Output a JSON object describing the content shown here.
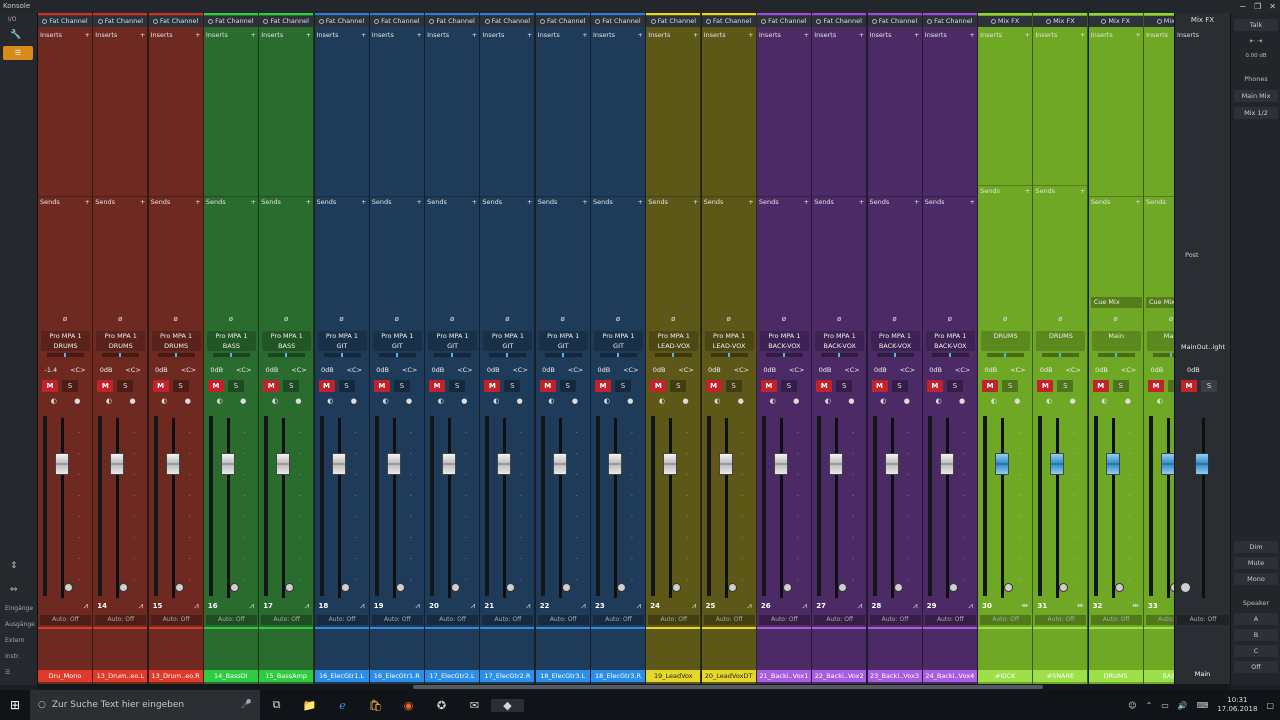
{
  "window": {
    "title": "Konsole",
    "controls": [
      "−",
      "❐",
      "✕"
    ]
  },
  "leftbar": {
    "io_label": "I/O",
    "orange_button": "☰",
    "bottom_buttons": [
      "Eingänge",
      "Ausgänge",
      "Extern",
      "Instr.",
      "☰"
    ]
  },
  "channels": [
    {
      "color": "#6e2a20",
      "top": "#c0392b",
      "header": "Fat Channel",
      "insert": "Inserts",
      "sends": "Sends",
      "plugin1": "Pro MPA 1",
      "plugin2": "DRUMS",
      "gain": "-1.4",
      "num": "",
      "name": "Dru_Mono",
      "band": "#e03a2a",
      "knob": "20"
    },
    {
      "color": "#6e2a20",
      "top": "#c0392b",
      "header": "Fat Channel",
      "insert": "Inserts",
      "sends": "Sends",
      "plugin1": "Pro MPA 1",
      "plugin2": "DRUMS",
      "gain": "0dB",
      "num": "14",
      "name": "13_Drum..eo.L",
      "band": "#e03a2a"
    },
    {
      "color": "#6e2a20",
      "top": "#c0392b",
      "header": "Fat Channel",
      "insert": "Inserts",
      "sends": "Sends",
      "plugin1": "Pro MPA 1",
      "plugin2": "DRUMS",
      "gain": "0dB",
      "num": "15",
      "name": "13_Drum..eo.R",
      "band": "#e03a2a"
    },
    {
      "color": "#2a6b2e",
      "top": "#2ecc40",
      "header": "Fat Channel",
      "insert": "Inserts",
      "sends": "Sends",
      "plugin1": "Pro MPA 1",
      "plugin2": "BASS",
      "gain": "0dB",
      "num": "16",
      "name": "14_BassDI",
      "band": "#2ecc40"
    },
    {
      "color": "#2a6b2e",
      "top": "#2ecc40",
      "header": "Fat Channel",
      "insert": "Inserts",
      "sends": "Sends",
      "plugin1": "Pro MPA 1",
      "plugin2": "BASS",
      "gain": "0dB",
      "num": "17",
      "name": "15_BassAmp",
      "band": "#2ecc40"
    },
    {
      "color": "#1f3b5a",
      "top": "#2d7dd2",
      "header": "Fat Channel",
      "insert": "Inserts",
      "sends": "Sends",
      "plugin1": "Pro MPA 1",
      "plugin2": "GIT",
      "gain": "0dB",
      "num": "18",
      "name": "16_ElecGtr1.L",
      "band": "#2d8ee8"
    },
    {
      "color": "#1f3b5a",
      "top": "#2d7dd2",
      "header": "Fat Channel",
      "insert": "Inserts",
      "sends": "Sends",
      "plugin1": "Pro MPA 1",
      "plugin2": "GIT",
      "gain": "0dB",
      "num": "19",
      "name": "16_ElecGtr1.R",
      "band": "#2d8ee8"
    },
    {
      "color": "#1f3b5a",
      "top": "#2d7dd2",
      "header": "Fat Channel",
      "insert": "Inserts",
      "sends": "Sends",
      "plugin1": "Pro MPA 1",
      "plugin2": "GIT",
      "gain": "0dB",
      "num": "20",
      "name": "17_ElecGtr2.L",
      "band": "#2d8ee8"
    },
    {
      "color": "#1f3b5a",
      "top": "#2d7dd2",
      "header": "Fat Channel",
      "insert": "Inserts",
      "sends": "Sends",
      "plugin1": "Pro MPA 1",
      "plugin2": "GIT",
      "gain": "0dB",
      "num": "21",
      "name": "17_ElecGtr2.R",
      "band": "#2d8ee8"
    },
    {
      "color": "#1f3b5a",
      "top": "#2d7dd2",
      "header": "Fat Channel",
      "insert": "Inserts",
      "sends": "Sends",
      "plugin1": "Pro MPA 1",
      "plugin2": "GIT",
      "gain": "0dB",
      "num": "22",
      "name": "18_ElecGtr3.L",
      "band": "#2d8ee8"
    },
    {
      "color": "#1f3b5a",
      "top": "#2d7dd2",
      "header": "Fat Channel",
      "insert": "Inserts",
      "sends": "Sends",
      "plugin1": "Pro MPA 1",
      "plugin2": "GIT",
      "gain": "0dB",
      "num": "23",
      "name": "18_ElecGtr3.R",
      "band": "#2d8ee8"
    },
    {
      "color": "#5e5818",
      "top": "#e5d82a",
      "header": "Fat Channel",
      "insert": "Inserts",
      "sends": "Sends",
      "plugin1": "Pro MPA 1",
      "plugin2": "LEAD-VOX",
      "gain": "0dB",
      "num": "24",
      "name": "19_LeadVox",
      "band": "#e5d82a"
    },
    {
      "color": "#5e5818",
      "top": "#e5d82a",
      "header": "Fat Channel",
      "insert": "Inserts",
      "sends": "Sends",
      "plugin1": "Pro MPA 1",
      "plugin2": "LEAD-VOX",
      "gain": "0dB",
      "num": "25",
      "name": "20_LeadVoxDT",
      "band": "#e5d82a"
    },
    {
      "color": "#4b2a66",
      "top": "#9b4fd4",
      "header": "Fat Channel",
      "insert": "Inserts",
      "sends": "Sends",
      "plugin1": "Pro MPA 1",
      "plugin2": "BACK-VOX",
      "gain": "0dB",
      "num": "26",
      "name": "21_Backi..Vox1",
      "band": "#a85ee0"
    },
    {
      "color": "#4b2a66",
      "top": "#9b4fd4",
      "header": "Fat Channel",
      "insert": "Inserts",
      "sends": "Sends",
      "plugin1": "Pro MPA 1",
      "plugin2": "BACK-VOX",
      "gain": "0dB",
      "num": "27",
      "name": "22_Backi..Vox2",
      "band": "#a85ee0"
    },
    {
      "color": "#4b2a66",
      "top": "#9b4fd4",
      "header": "Fat Channel",
      "insert": "Inserts",
      "sends": "Sends",
      "plugin1": "Pro MPA 1",
      "plugin2": "BACK-VOX",
      "gain": "0dB",
      "num": "28",
      "name": "23_Backi..Vox3",
      "band": "#a85ee0"
    },
    {
      "color": "#4b2a66",
      "top": "#9b4fd4",
      "header": "Fat Channel",
      "insert": "Inserts",
      "sends": "Sends",
      "plugin1": "Pro MPA 1",
      "plugin2": "BACK-VOX",
      "gain": "0dB",
      "num": "29",
      "name": "24_Backi..Vox4",
      "band": "#a85ee0"
    },
    {
      "color": "#6fa824",
      "top": "#8fd43a",
      "header": "Mix FX",
      "insert": "Inserts",
      "sends": "Sends",
      "plugin1": "",
      "plugin2": "DRUMS",
      "gain": "0dB",
      "num": "30",
      "name": "#KICK",
      "band": "#9de04a",
      "mixfx": true,
      "blue": true
    },
    {
      "color": "#6fa824",
      "top": "#8fd43a",
      "header": "Mix FX",
      "insert": "Inserts",
      "sends": "Sends",
      "plugin1": "",
      "plugin2": "DRUMS",
      "gain": "0dB",
      "num": "31",
      "name": "#SNARE",
      "band": "#9de04a",
      "mixfx": true,
      "blue": true
    },
    {
      "color": "#6fa824",
      "top": "#8fd43a",
      "header": "Mix FX",
      "insert": "Inserts",
      "sends": "Sends",
      "plugin1": "",
      "plugin2": "Main",
      "gain": "0dB",
      "num": "32",
      "name": "DRUMS",
      "band": "#9de04a",
      "mixfx": true,
      "blue": true,
      "cue": "Cue Mix"
    },
    {
      "color": "#6fa824",
      "top": "#8fd43a",
      "header": "Mix FX",
      "insert": "Inserts",
      "sends": "Sends",
      "plugin1": "",
      "plugin2": "Main",
      "gain": "0dB",
      "num": "33",
      "name": "BASS",
      "band": "#9de04a",
      "mixfx": true,
      "blue": true,
      "cue": "Cue Mix"
    }
  ],
  "strip_labels": {
    "mute": "M",
    "solo": "S",
    "phase": "ø",
    "link": "<C>",
    "auto": "Auto: Off",
    "plus": "+"
  },
  "output": {
    "header": "Mix FX",
    "insert": "Inserts",
    "post": "Post",
    "plugin": "MainOut..ight",
    "gain": "0dB",
    "auto": "Auto: Off",
    "name": "Main"
  },
  "rightpanel": {
    "talk": "Talk",
    "level": "0.00 dB",
    "phones": "Phones",
    "main_mix": "Main Mix",
    "mix12": "Mix 1/2",
    "dim": "Dim",
    "mute": "Mute",
    "mono": "Mono",
    "speaker": "Speaker",
    "a": "A",
    "b": "B",
    "c": "C",
    "off": "Off"
  },
  "taskbar": {
    "search_placeholder": "Zur Suche Text hier eingeben",
    "time": "10:31",
    "date": "17.06.2018"
  },
  "colors": {
    "background": "#1b1e22",
    "mute_red": "#c4222a",
    "fader_blue": "#3a8fc7"
  }
}
